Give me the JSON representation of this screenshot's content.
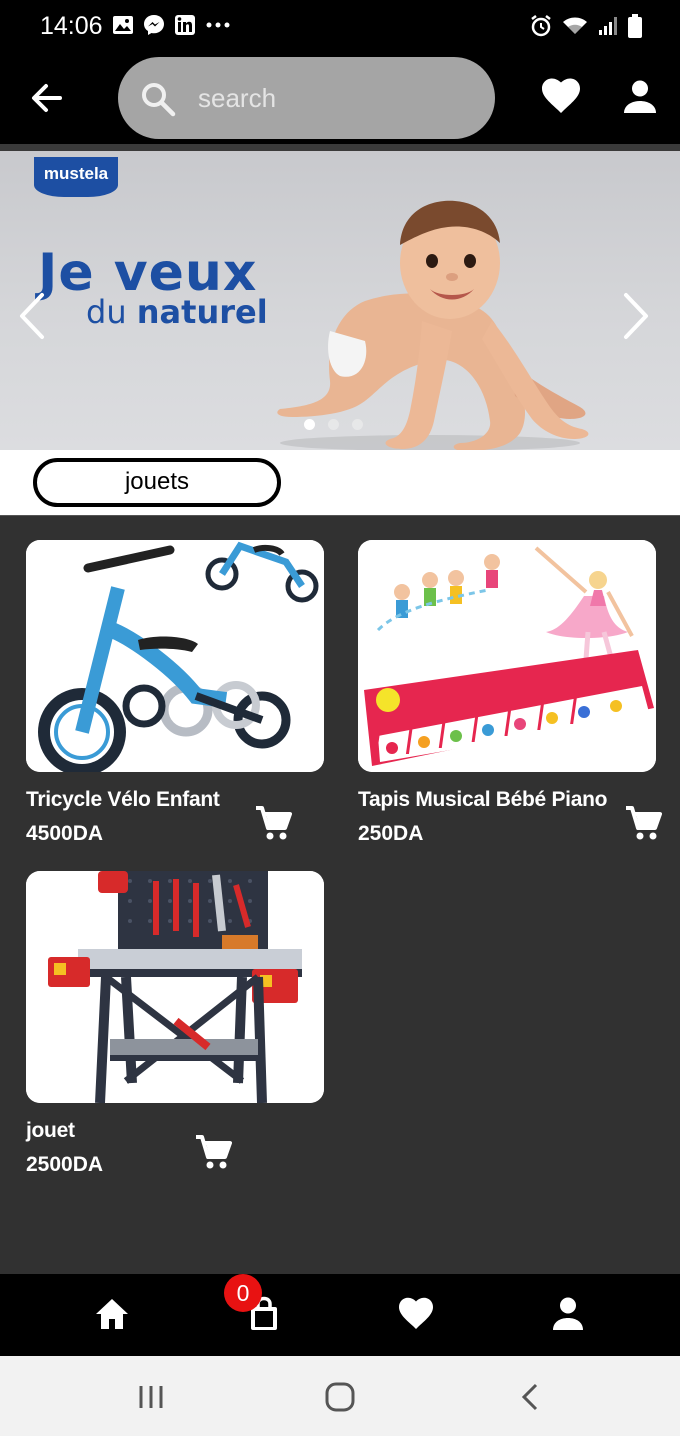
{
  "status_bar": {
    "time": "14:06",
    "left_icons": [
      "image-icon",
      "messenger-icon",
      "linkedin-icon",
      "more-dots-icon"
    ],
    "right_icons": [
      "alarm-icon",
      "wifi-icon",
      "signal-icon",
      "battery-icon"
    ]
  },
  "header": {
    "search_placeholder": "search",
    "icons": [
      "back-arrow-icon",
      "search-icon",
      "heart-icon",
      "user-icon"
    ]
  },
  "banner": {
    "brand": "mustela",
    "headline": "Je veux",
    "subline_light": "du",
    "subline_bold": "naturel",
    "slide_count": 3,
    "active_slide": 1
  },
  "category": {
    "selected": "jouets"
  },
  "products": [
    {
      "name": "Tricycle Vélo Enfant",
      "price": "4500DA"
    },
    {
      "name": "Tapis Musical Bébé Piano",
      "price": "250DA"
    },
    {
      "name": "jouet",
      "price": "2500DA"
    }
  ],
  "bottom_nav": {
    "items": [
      "home-icon",
      "shopping-bag-icon",
      "heart-icon",
      "user-icon"
    ],
    "cart_count": "0"
  },
  "colors": {
    "brand_blue": "#1d4fa3",
    "badge_red": "#e81212",
    "grid_background": "#313131",
    "search_background": "#a5a5a5"
  }
}
